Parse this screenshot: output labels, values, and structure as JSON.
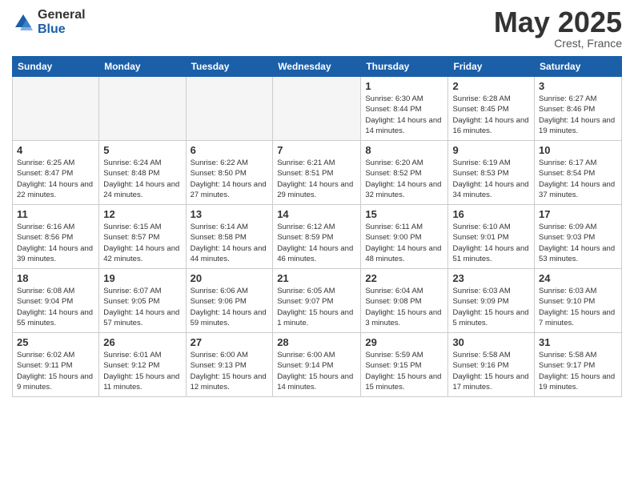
{
  "logo": {
    "general": "General",
    "blue": "Blue"
  },
  "title": "May 2025",
  "location": "Crest, France",
  "headers": [
    "Sunday",
    "Monday",
    "Tuesday",
    "Wednesday",
    "Thursday",
    "Friday",
    "Saturday"
  ],
  "weeks": [
    [
      {
        "num": "",
        "info": ""
      },
      {
        "num": "",
        "info": ""
      },
      {
        "num": "",
        "info": ""
      },
      {
        "num": "",
        "info": ""
      },
      {
        "num": "1",
        "info": "Sunrise: 6:30 AM\nSunset: 8:44 PM\nDaylight: 14 hours\nand 14 minutes."
      },
      {
        "num": "2",
        "info": "Sunrise: 6:28 AM\nSunset: 8:45 PM\nDaylight: 14 hours\nand 16 minutes."
      },
      {
        "num": "3",
        "info": "Sunrise: 6:27 AM\nSunset: 8:46 PM\nDaylight: 14 hours\nand 19 minutes."
      }
    ],
    [
      {
        "num": "4",
        "info": "Sunrise: 6:25 AM\nSunset: 8:47 PM\nDaylight: 14 hours\nand 22 minutes."
      },
      {
        "num": "5",
        "info": "Sunrise: 6:24 AM\nSunset: 8:48 PM\nDaylight: 14 hours\nand 24 minutes."
      },
      {
        "num": "6",
        "info": "Sunrise: 6:22 AM\nSunset: 8:50 PM\nDaylight: 14 hours\nand 27 minutes."
      },
      {
        "num": "7",
        "info": "Sunrise: 6:21 AM\nSunset: 8:51 PM\nDaylight: 14 hours\nand 29 minutes."
      },
      {
        "num": "8",
        "info": "Sunrise: 6:20 AM\nSunset: 8:52 PM\nDaylight: 14 hours\nand 32 minutes."
      },
      {
        "num": "9",
        "info": "Sunrise: 6:19 AM\nSunset: 8:53 PM\nDaylight: 14 hours\nand 34 minutes."
      },
      {
        "num": "10",
        "info": "Sunrise: 6:17 AM\nSunset: 8:54 PM\nDaylight: 14 hours\nand 37 minutes."
      }
    ],
    [
      {
        "num": "11",
        "info": "Sunrise: 6:16 AM\nSunset: 8:56 PM\nDaylight: 14 hours\nand 39 minutes."
      },
      {
        "num": "12",
        "info": "Sunrise: 6:15 AM\nSunset: 8:57 PM\nDaylight: 14 hours\nand 42 minutes."
      },
      {
        "num": "13",
        "info": "Sunrise: 6:14 AM\nSunset: 8:58 PM\nDaylight: 14 hours\nand 44 minutes."
      },
      {
        "num": "14",
        "info": "Sunrise: 6:12 AM\nSunset: 8:59 PM\nDaylight: 14 hours\nand 46 minutes."
      },
      {
        "num": "15",
        "info": "Sunrise: 6:11 AM\nSunset: 9:00 PM\nDaylight: 14 hours\nand 48 minutes."
      },
      {
        "num": "16",
        "info": "Sunrise: 6:10 AM\nSunset: 9:01 PM\nDaylight: 14 hours\nand 51 minutes."
      },
      {
        "num": "17",
        "info": "Sunrise: 6:09 AM\nSunset: 9:03 PM\nDaylight: 14 hours\nand 53 minutes."
      }
    ],
    [
      {
        "num": "18",
        "info": "Sunrise: 6:08 AM\nSunset: 9:04 PM\nDaylight: 14 hours\nand 55 minutes."
      },
      {
        "num": "19",
        "info": "Sunrise: 6:07 AM\nSunset: 9:05 PM\nDaylight: 14 hours\nand 57 minutes."
      },
      {
        "num": "20",
        "info": "Sunrise: 6:06 AM\nSunset: 9:06 PM\nDaylight: 14 hours\nand 59 minutes."
      },
      {
        "num": "21",
        "info": "Sunrise: 6:05 AM\nSunset: 9:07 PM\nDaylight: 15 hours\nand 1 minute."
      },
      {
        "num": "22",
        "info": "Sunrise: 6:04 AM\nSunset: 9:08 PM\nDaylight: 15 hours\nand 3 minutes."
      },
      {
        "num": "23",
        "info": "Sunrise: 6:03 AM\nSunset: 9:09 PM\nDaylight: 15 hours\nand 5 minutes."
      },
      {
        "num": "24",
        "info": "Sunrise: 6:03 AM\nSunset: 9:10 PM\nDaylight: 15 hours\nand 7 minutes."
      }
    ],
    [
      {
        "num": "25",
        "info": "Sunrise: 6:02 AM\nSunset: 9:11 PM\nDaylight: 15 hours\nand 9 minutes."
      },
      {
        "num": "26",
        "info": "Sunrise: 6:01 AM\nSunset: 9:12 PM\nDaylight: 15 hours\nand 11 minutes."
      },
      {
        "num": "27",
        "info": "Sunrise: 6:00 AM\nSunset: 9:13 PM\nDaylight: 15 hours\nand 12 minutes."
      },
      {
        "num": "28",
        "info": "Sunrise: 6:00 AM\nSunset: 9:14 PM\nDaylight: 15 hours\nand 14 minutes."
      },
      {
        "num": "29",
        "info": "Sunrise: 5:59 AM\nSunset: 9:15 PM\nDaylight: 15 hours\nand 15 minutes."
      },
      {
        "num": "30",
        "info": "Sunrise: 5:58 AM\nSunset: 9:16 PM\nDaylight: 15 hours\nand 17 minutes."
      },
      {
        "num": "31",
        "info": "Sunrise: 5:58 AM\nSunset: 9:17 PM\nDaylight: 15 hours\nand 19 minutes."
      }
    ]
  ]
}
